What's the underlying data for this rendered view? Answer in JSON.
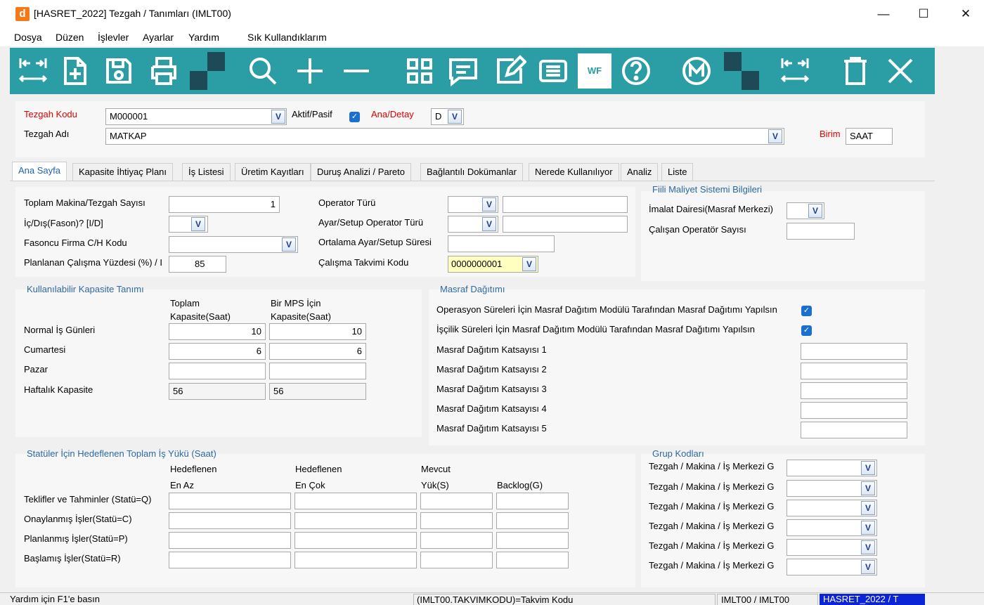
{
  "window": {
    "app_icon": "d",
    "title": "[HASRET_2022] Tezgah /  Tanımları  (IMLT00)",
    "minimize": "—",
    "maximize": "☐",
    "close": "✕"
  },
  "menu": [
    "Dosya",
    "Düzen",
    "İşlevler",
    "Ayarlar",
    "Yardım",
    "Sık Kullandıklarım"
  ],
  "toolbar": {
    "wf_label": "WF",
    "icons": [
      "first-record-icon",
      "new-record-icon",
      "save-icon",
      "print-icon",
      "search-icon",
      "add-icon",
      "remove-icon",
      "grid-icon",
      "comment-icon",
      "edit-icon",
      "list-icon",
      "workflow-icon",
      "help-icon",
      "m-icon",
      "collapse-icon",
      "delete-icon",
      "close-icon"
    ],
    "color": "#2a9ea4"
  },
  "header": {
    "code_label": "Tezgah Kodu",
    "code_value": "M000001",
    "active_label": "Aktif/Pasif",
    "main_detail_label": "Ana/Detay",
    "main_detail_value": "D",
    "name_label": "Tezgah Adı",
    "name_value": "MATKAP",
    "unit_label": "Birim",
    "unit_value": "SAAT"
  },
  "tabs": [
    "Ana Sayfa",
    "Kapasite İhtiyaç Planı",
    "İş Listesi",
    "Üretim Kayıtları",
    "Duruş Analizi / Pareto",
    "Bağlantılı Dokümanlar",
    "Nerede Kullanılıyor",
    "Analiz",
    "Liste"
  ],
  "general": {
    "machine_count_label": "Toplam Makina/Tezgah Sayısı",
    "machine_count_value": "1",
    "internal_label": "İç/Dış(Fason)? [I/D]",
    "subcontractor_label": "Fasoncu Firma C/H Kodu",
    "planned_pct_label": "Planlanan Çalışma Yüzdesi (%) / I",
    "planned_pct_value": "85",
    "operator_type_label": "Operator Türü",
    "setup_operator_label": "Ayar/Setup Operator Türü",
    "avg_setup_label": "Ortalama Ayar/Setup Süresi",
    "calendar_label": "Çalışma Takvimi Kodu",
    "calendar_value": "0000000001"
  },
  "cost_system": {
    "title": "Fiili Maliyet Sistemi Bilgileri",
    "dept_label": "İmalat Dairesi(Masraf Merkezi)",
    "operators_label": "Çalışan Operatör Sayısı"
  },
  "capacity": {
    "title": "Kullanılabilir Kapasite Tanımı",
    "col1_line1": "Toplam",
    "col1_line2": "Kapasite(Saat)",
    "col2_line1": "Bir MPS İçin",
    "col2_line2": "Kapasite(Saat)",
    "rows": [
      {
        "label": "Normal İş Günleri",
        "total": "10",
        "mps": "10"
      },
      {
        "label": "Cumartesi",
        "total": "6",
        "mps": "6"
      },
      {
        "label": "Pazar",
        "total": "",
        "mps": ""
      },
      {
        "label": "Haftalık Kapasite",
        "total": "56",
        "mps": "56"
      }
    ]
  },
  "cost_distribution": {
    "title": "Masraf Dağıtımı",
    "op_label": "Operasyon Süreleri İçin Masraf Dağıtım Modülü Tarafından Masraf Dağıtımı Yapılsın",
    "labor_label": "İşçilik Süreleri İçin Masraf Dağıtım Modülü Tarafından Masraf Dağıtımı Yapılsın",
    "coefficients": [
      "Masraf Dağıtım Katsayısı 1",
      "Masraf Dağıtım Katsayısı 2",
      "Masraf Dağıtım Katsayısı 3",
      "Masraf Dağıtım Katsayısı 4",
      "Masraf Dağıtım Katsayısı 5"
    ]
  },
  "workload": {
    "title": "Statüler İçin Hedeflenen Toplam İş Yükü (Saat)",
    "h1_line1": "Hedeflenen",
    "h1_line2": "En Az",
    "h2_line1": "Hedeflenen",
    "h2_line2": "En Çok",
    "h3_line1": "Mevcut",
    "h3_line2": "Yük(S)",
    "h4_line2": "Backlog(G)",
    "rows": [
      "Teklifler ve Tahminler (Statü=Q)",
      "Onaylanmış İşler(Statü=C)",
      "Planlanmış İşler(Statü=P)",
      "Başlamış İşler(Statü=R)"
    ]
  },
  "group_codes": {
    "title": "Grup Kodları",
    "rows": [
      "Tezgah / Makina / İş Merkezi G",
      "Tezgah / Makina / İş Merkezi G",
      "Tezgah / Makina / İş Merkezi G",
      "Tezgah / Makina / İş Merkezi G",
      "Tezgah / Makina / İş Merkezi G",
      "Tezgah / Makina / İş Merkezi G"
    ]
  },
  "status": {
    "help": "Yardım için F1'e basın",
    "field": "(IMLT00.TAKVIMKODU)=Takvim Kodu",
    "module": "IMLT00 / IMLT00",
    "company": "HASRET_2022 / T"
  },
  "dropdown_glyph": "V",
  "check_glyph": "✓"
}
